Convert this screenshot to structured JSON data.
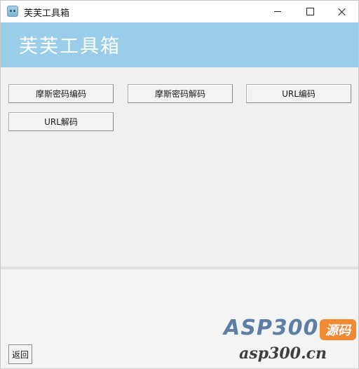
{
  "window": {
    "title": "芙芙工具箱",
    "minimize_icon": "minimize-icon",
    "maximize_icon": "maximize-icon",
    "close_icon": "close-icon"
  },
  "header": {
    "title": "芙芙工具箱",
    "background": "#99cdea"
  },
  "tools": {
    "morse_encode": "摩斯密码编码",
    "morse_decode": "摩斯密码解码",
    "url_encode": "URL编码",
    "url_decode": "URL解码"
  },
  "footer": {
    "back_label": "返回"
  },
  "watermark": {
    "main": "ASP300",
    "badge": "源码",
    "sub": "asp300.cn",
    "badge_color": "#f08a34"
  }
}
